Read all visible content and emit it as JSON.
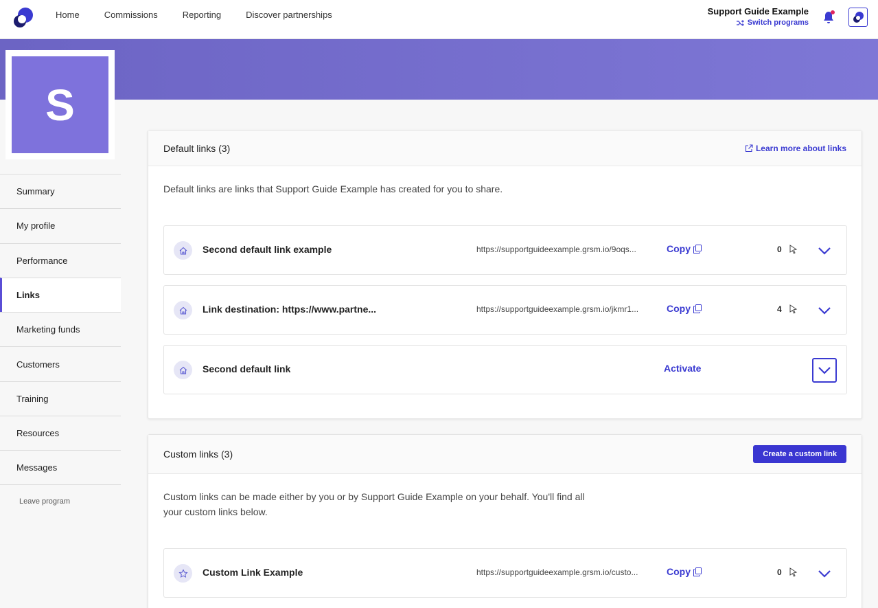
{
  "nav": {
    "links": [
      "Home",
      "Commissions",
      "Reporting",
      "Discover partnerships"
    ],
    "program_name": "Support Guide Example",
    "switch_label": "Switch programs"
  },
  "profile": {
    "initial": "S"
  },
  "sidebar": {
    "items": [
      {
        "label": "Summary"
      },
      {
        "label": "My profile"
      },
      {
        "label": "Performance"
      },
      {
        "label": "Links"
      },
      {
        "label": "Marketing funds"
      },
      {
        "label": "Customers"
      },
      {
        "label": "Training"
      },
      {
        "label": "Resources"
      },
      {
        "label": "Messages"
      }
    ],
    "active": "Links",
    "leave_label": "Leave program"
  },
  "default_links": {
    "title": "Default links (3)",
    "learn_more": "Learn more about links",
    "description": "Default links are links that Support Guide Example has created for you to share.",
    "rows": [
      {
        "name": "Second default link example",
        "url": "https://supportguideexample.grsm.io/9oqs...",
        "copy": "Copy",
        "count": "0",
        "icon": "home-icon"
      },
      {
        "name": "Link destination: https://www.partne...",
        "url": "https://supportguideexample.grsm.io/jkmr1...",
        "copy": "Copy",
        "count": "4",
        "icon": "home-icon"
      },
      {
        "name": "Second default link",
        "activate": "Activate",
        "icon": "home-icon"
      }
    ]
  },
  "custom_links": {
    "title": "Custom links (3)",
    "create_label": "Create a custom link",
    "description": "Custom links can be made either by you or by Support Guide Example on your behalf. You'll find all your custom links below.",
    "rows": [
      {
        "name": "Custom Link Example",
        "url": "https://supportguideexample.grsm.io/custo...",
        "copy": "Copy",
        "count": "0",
        "icon": "star-icon"
      }
    ]
  },
  "colors": {
    "accent": "#3a3ad1",
    "banner": "#7169cc",
    "avatar": "#7e72dc"
  }
}
